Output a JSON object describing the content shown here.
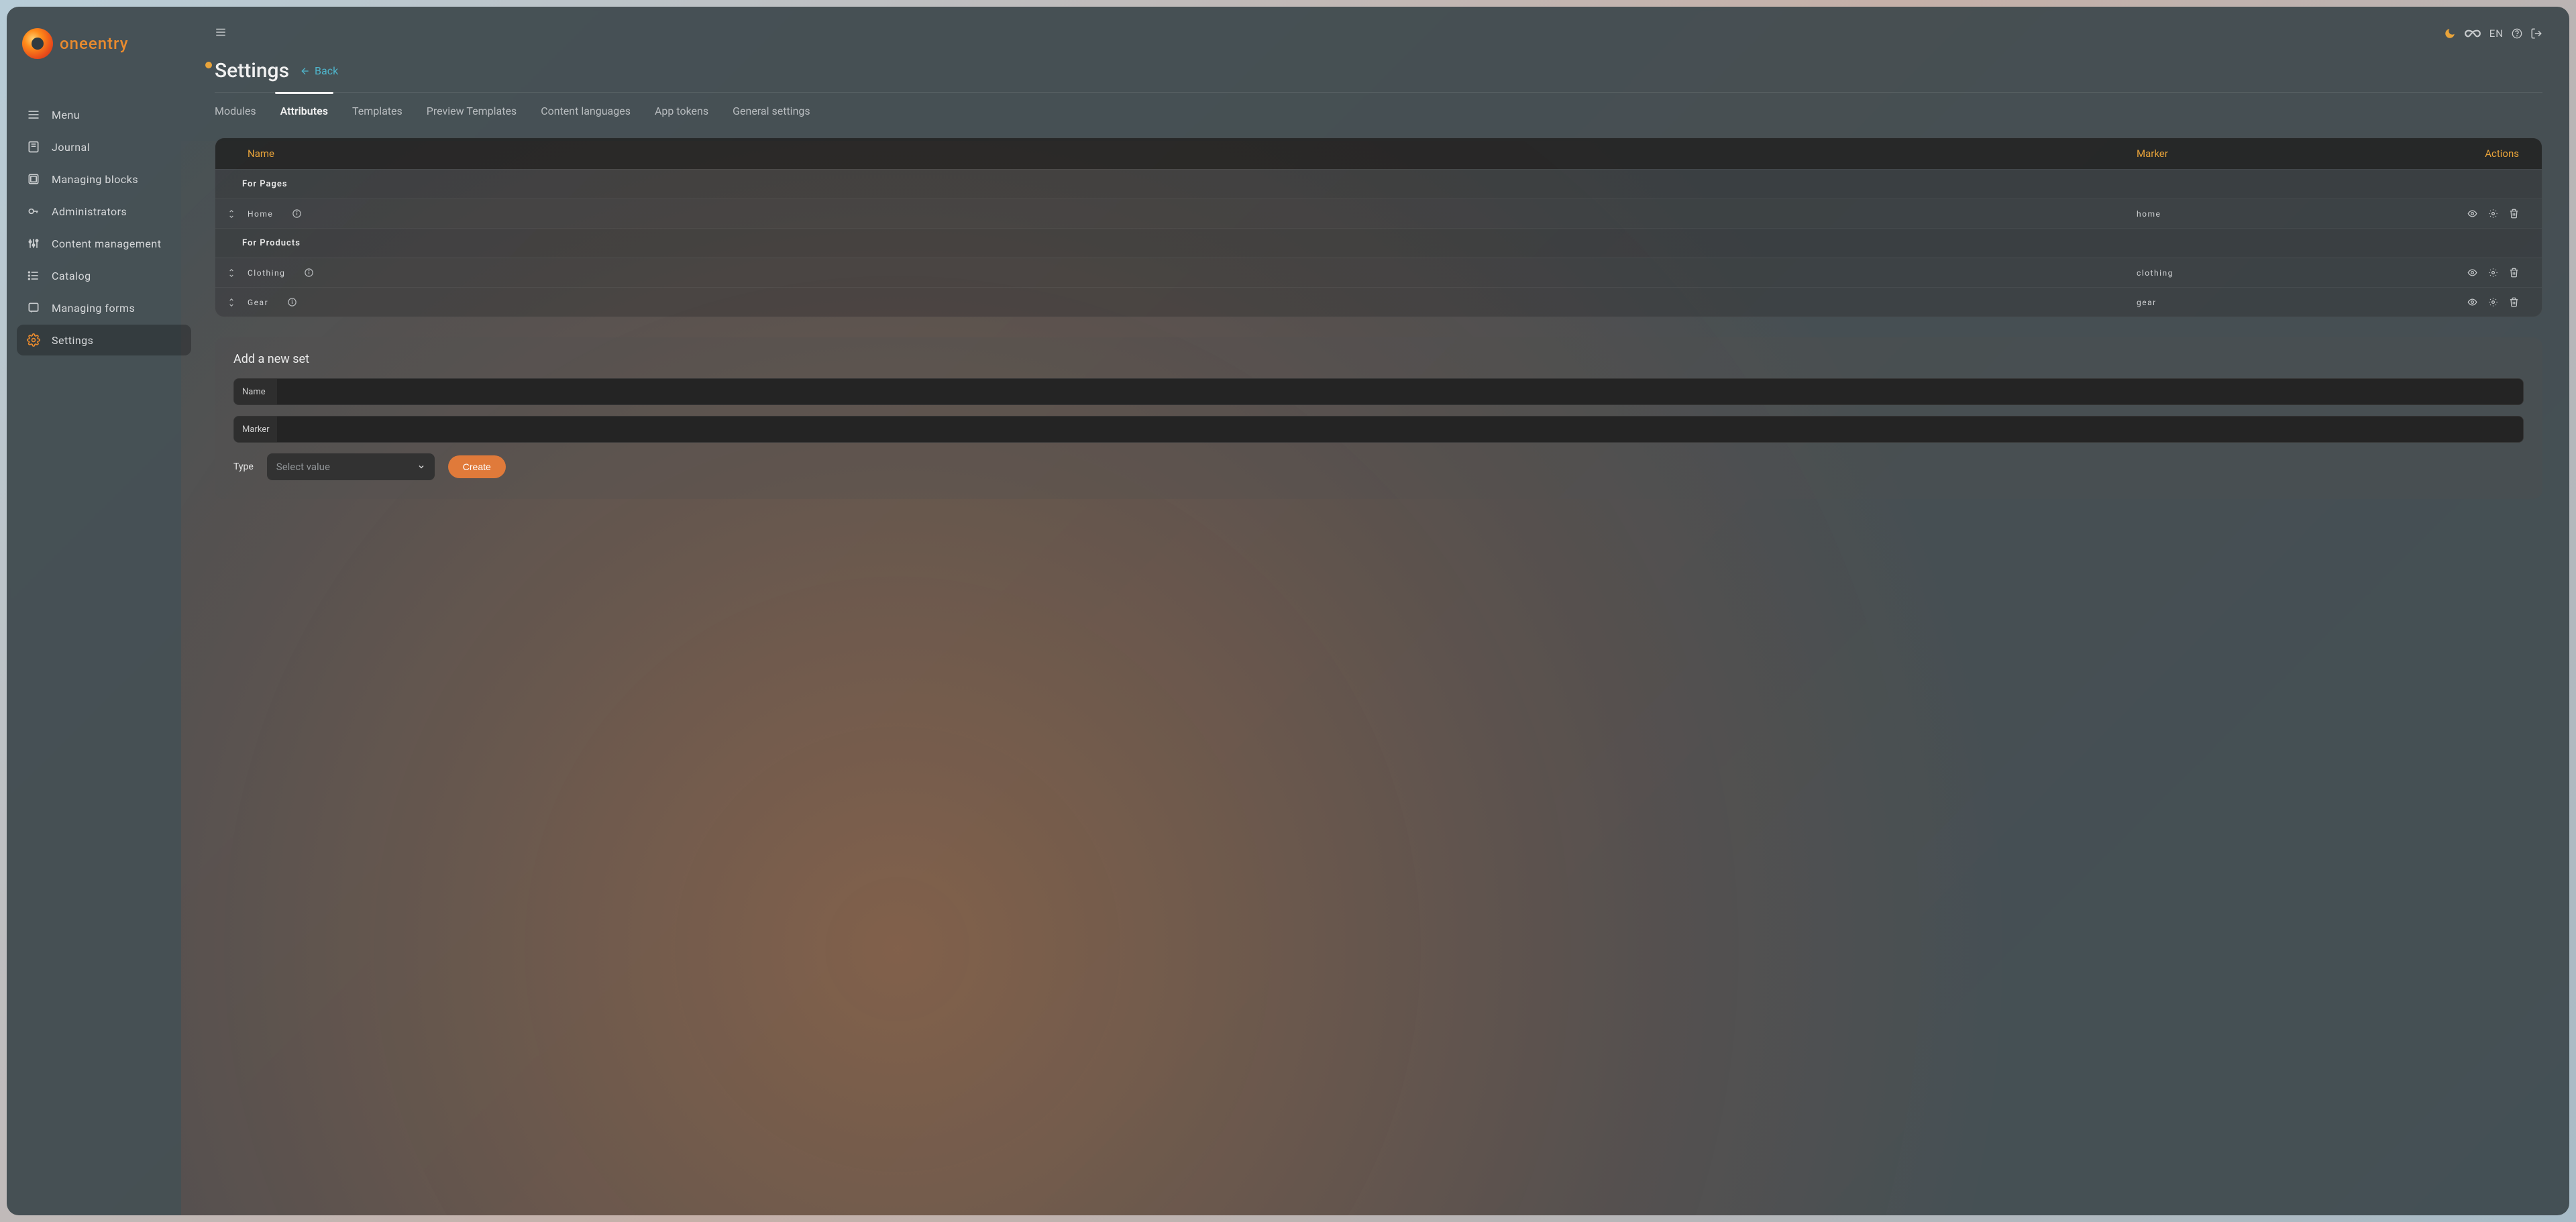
{
  "brand": {
    "name": "oneentry"
  },
  "topbar": {
    "lang": "EN"
  },
  "sidebar": {
    "items": [
      {
        "label": "Menu"
      },
      {
        "label": "Journal"
      },
      {
        "label": "Managing blocks"
      },
      {
        "label": "Administrators"
      },
      {
        "label": "Content management"
      },
      {
        "label": "Catalog"
      },
      {
        "label": "Managing forms"
      },
      {
        "label": "Settings"
      }
    ],
    "active_index": 7
  },
  "page": {
    "title": "Settings",
    "back_label": "Back"
  },
  "tabs": {
    "items": [
      "Modules",
      "Attributes",
      "Templates",
      "Preview Templates",
      "Content languages",
      "App tokens",
      "General settings"
    ],
    "active_index": 1
  },
  "table": {
    "headers": {
      "name": "Name",
      "marker": "Marker",
      "actions": "Actions"
    },
    "groups": [
      {
        "title": "For Pages",
        "rows": [
          {
            "name": "Home",
            "marker": "home"
          }
        ]
      },
      {
        "title": "For Products",
        "rows": [
          {
            "name": "Clothing",
            "marker": "clothing"
          },
          {
            "name": "Gear",
            "marker": "gear"
          }
        ]
      }
    ]
  },
  "form": {
    "title": "Add a new set",
    "name_label": "Name",
    "name_value": "",
    "marker_label": "Marker",
    "marker_value": "",
    "type_label": "Type",
    "type_placeholder": "Select value",
    "create_label": "Create"
  },
  "colors": {
    "accent": "#e88a2e",
    "link": "#4fb3c9"
  }
}
